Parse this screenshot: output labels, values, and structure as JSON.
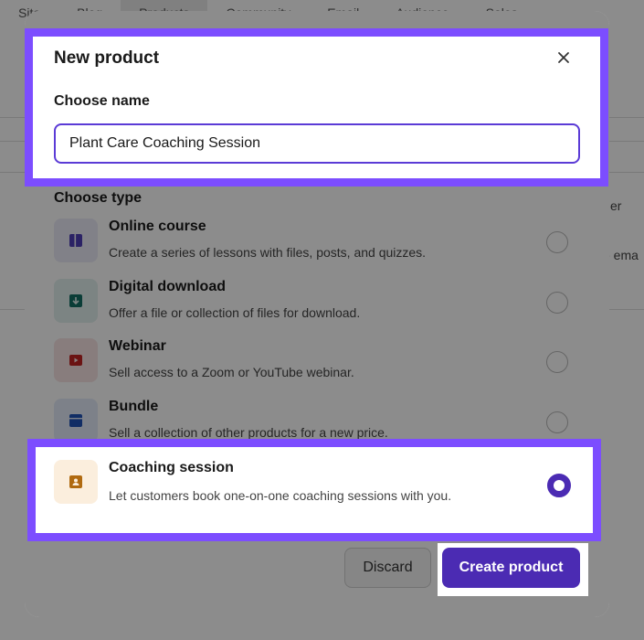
{
  "background": {
    "tabs": [
      "Site",
      "Blog",
      "Products",
      "Community",
      "Email",
      "Audience",
      "Sales"
    ],
    "right_text_1": "er",
    "right_text_2": "e ema"
  },
  "modal": {
    "title": "New product",
    "close_icon": "close-icon",
    "name_label": "Choose name",
    "name_value": "Plant Care Coaching Session",
    "type_label": "Choose type",
    "options": [
      {
        "title": "Online course",
        "desc": "Create a series of lessons with files, posts, and quizzes.",
        "icon": "course-icon",
        "icon_bg": "#ecebf8",
        "icon_color": "#4f3fb8"
      },
      {
        "title": "Digital download",
        "desc": "Offer a file or collection of files for download.",
        "icon": "download-icon",
        "icon_bg": "#e2f0ee",
        "icon_color": "#137064"
      },
      {
        "title": "Webinar",
        "desc": "Sell access to a Zoom or YouTube webinar.",
        "icon": "play-icon",
        "icon_bg": "#f8e4e4",
        "icon_color": "#c42424"
      },
      {
        "title": "Bundle",
        "desc": "Sell a collection of other products for a new price.",
        "icon": "bundle-icon",
        "icon_bg": "#e4ecf9",
        "icon_color": "#1f52b8"
      }
    ],
    "selected_option": {
      "title": "Coaching session",
      "desc": "Let customers book one-on-one coaching sessions with you.",
      "icon": "person-icon",
      "icon_bg": "#fbeedd",
      "icon_color": "#b06a10"
    },
    "discard_label": "Discard",
    "create_label": "Create product"
  },
  "colors": {
    "accent": "#4b2bb3",
    "highlight": "#7c4dff"
  }
}
